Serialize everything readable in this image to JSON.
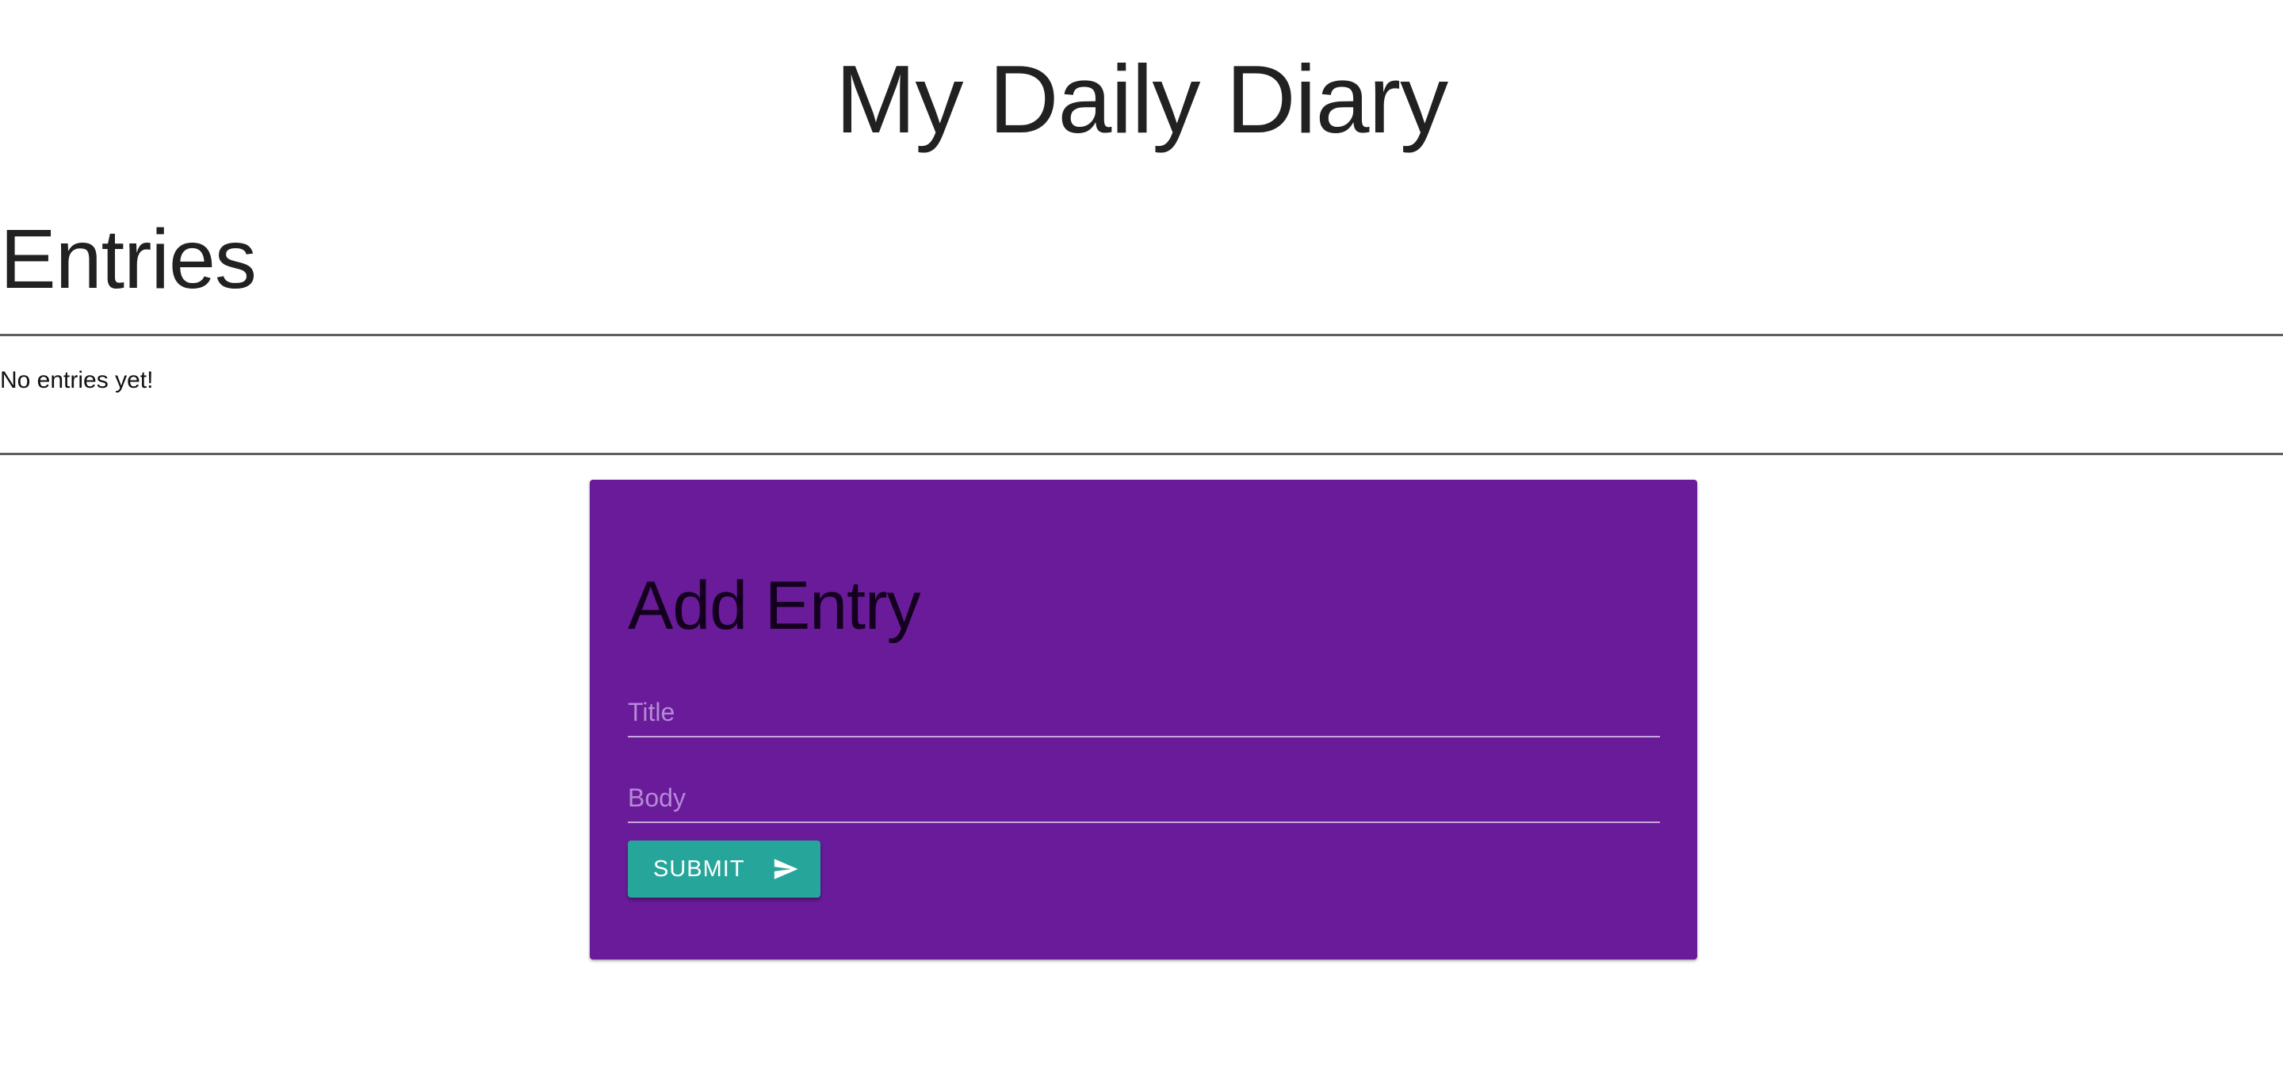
{
  "header": {
    "title": "My Daily Diary"
  },
  "entries": {
    "heading": "Entries",
    "empty_message": "No entries yet!"
  },
  "add_entry": {
    "heading": "Add Entry",
    "title_placeholder": "Title",
    "body_placeholder": "Body",
    "submit_label": "SUBMIT",
    "submit_icon": "send-icon"
  },
  "colors": {
    "card_background": "#6a1b9a",
    "submit_button": "#26a69a"
  }
}
